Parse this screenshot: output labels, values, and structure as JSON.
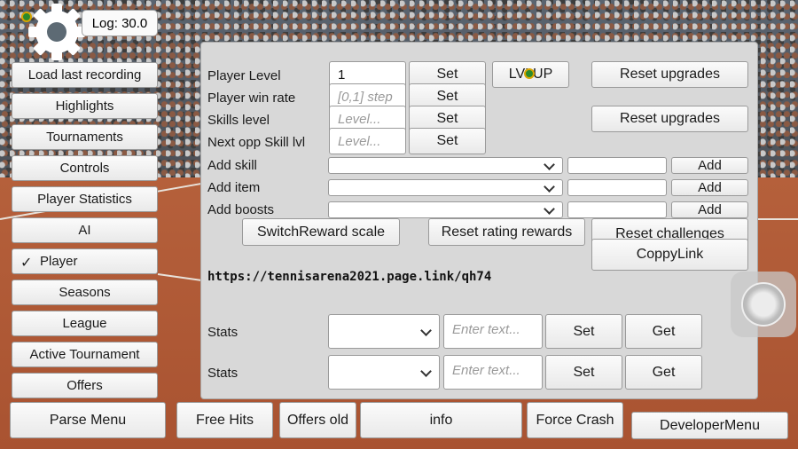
{
  "log": "Log: 30.0",
  "sidebar": {
    "items": [
      {
        "label": "Load last recording"
      },
      {
        "label": "Highlights"
      },
      {
        "label": "Tournaments"
      },
      {
        "label": "Controls"
      },
      {
        "label": "Player Statistics"
      },
      {
        "label": "AI"
      },
      {
        "label": "Player",
        "checked": true
      },
      {
        "label": "Seasons"
      },
      {
        "label": "League"
      },
      {
        "label": "Active Tournament"
      },
      {
        "label": "Offers"
      }
    ],
    "check_mark": "✓"
  },
  "panel": {
    "player_level": {
      "label": "Player Level",
      "value": "1",
      "set": "Set"
    },
    "lvl_up": "LVLUP",
    "reset_upgrades_1": "Reset upgrades",
    "player_win_rate": {
      "label": "Player win rate",
      "placeholder": "[0,1] step",
      "set": "Set"
    },
    "skills_level": {
      "label": "Skills level",
      "placeholder": "Level...",
      "set": "Set"
    },
    "reset_upgrades_2": "Reset upgrades",
    "next_opp": {
      "label": "Next opp Skill lvl",
      "placeholder": "Level...",
      "set": "Set"
    },
    "add_skill": {
      "label": "Add skill",
      "add": "Add"
    },
    "add_item": {
      "label": "Add item",
      "add": "Add"
    },
    "add_boosts": {
      "label": "Add boosts",
      "add": "Add"
    },
    "switch_reward": "SwitchReward scale",
    "reset_rating": "Reset rating rewards",
    "reset_challenges": "Reset challenges",
    "copy_link": "CoppyLink",
    "link": "https://tennisarena2021.page.link/qh74",
    "stats": [
      {
        "label": "Stats",
        "placeholder": "Enter text...",
        "set": "Set",
        "get": "Get"
      },
      {
        "label": "Stats",
        "placeholder": "Enter text...",
        "set": "Set",
        "get": "Get"
      }
    ]
  },
  "bottom": {
    "parse_menu": "Parse Menu",
    "free_hits": "Free Hits",
    "offers_old": "Offers old",
    "info": "info",
    "force_crash": "Force Crash",
    "developer_menu": "DeveloperMenu"
  }
}
